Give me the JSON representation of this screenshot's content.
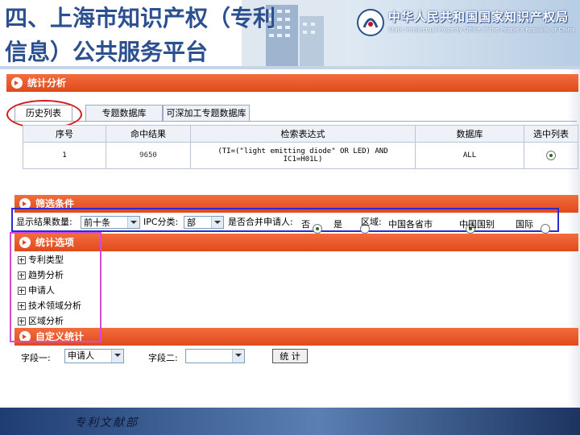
{
  "header": {
    "slide_title": "四、上海市知识产权（专利信息）公共服务平台",
    "org_name_cn": "中华人民共和国国家知识产权局",
    "org_name_en": "State Intellectual Property Office of the People's Republic of China"
  },
  "stats_section": {
    "title": "统计分析"
  },
  "tabs": [
    {
      "label": "历史列表",
      "active": true
    },
    {
      "label": "专题数据库",
      "active": false
    },
    {
      "label": "可深加工专题数据库",
      "active": false
    }
  ],
  "history_table": {
    "columns": [
      "序号",
      "命中结果",
      "检索表达式",
      "数据库",
      "选中列表"
    ],
    "rows": [
      {
        "index": "1",
        "hits": "9650",
        "expr_line1": "(TI=(\"light emitting diode\" OR LED) AND",
        "expr_line2": "IC1=H01L)",
        "database": "ALL",
        "selected": true
      }
    ]
  },
  "filter_section": {
    "title": "筛选条件",
    "display_count_label": "显示结果数量:",
    "display_count_value": "前十条",
    "ipc_label": "IPC分类:",
    "ipc_value": "部",
    "merge_label": "是否合并申请人:",
    "merge_no": "否",
    "merge_yes": "是",
    "region_label": "区域:",
    "region_option1": "中国各省市",
    "region_option2": "中国国别",
    "region_option3": "国际"
  },
  "stat_items_section": {
    "title": "统计选项",
    "items": [
      "专利类型",
      "趋势分析",
      "申请人",
      "技术领域分析",
      "区域分析"
    ]
  },
  "custom_section": {
    "title": "自定义统计",
    "field1_label": "字段一:",
    "field1_value": "申请人",
    "field2_label": "字段二:",
    "field2_value": "",
    "submit_label": "统 计"
  },
  "footer": {
    "text": "专利文献部"
  },
  "colors": {
    "section_bar": "#e04a1c",
    "title_blue": "#2c4f8f",
    "highlight_red": "#d31b1b",
    "highlight_blue": "#2b2bd6",
    "highlight_magenta": "#d24cd9"
  }
}
